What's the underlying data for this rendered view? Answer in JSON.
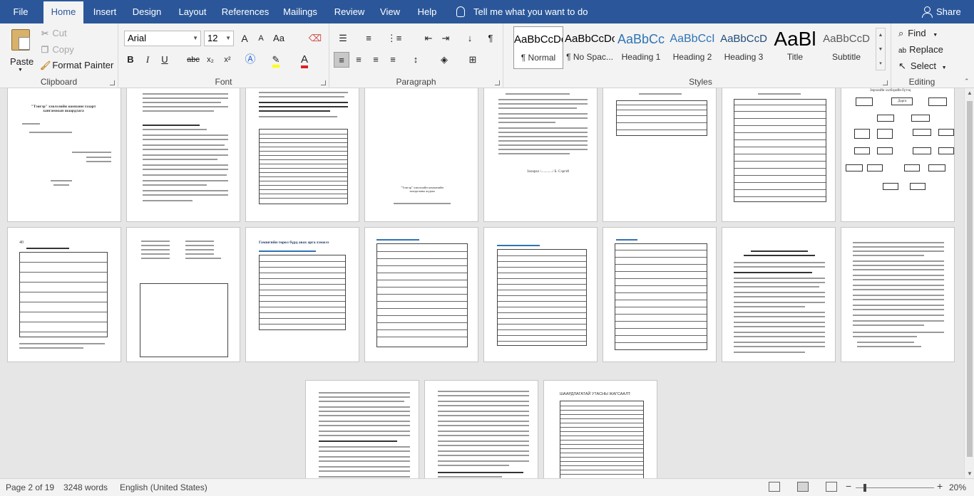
{
  "tabs": [
    "File",
    "Home",
    "Insert",
    "Design",
    "Layout",
    "References",
    "Mailings",
    "Review",
    "View",
    "Help"
  ],
  "active_tab": "Home",
  "tell_me": "Tell me what you want to do",
  "share": "Share",
  "clipboard": {
    "paste": "Paste",
    "cut": "Cut",
    "copy": "Copy",
    "format_painter": "Format Painter",
    "label": "Clipboard"
  },
  "font": {
    "name": "Arial",
    "size": "12",
    "label": "Font",
    "bold": "B",
    "italic": "I",
    "underline": "U",
    "strike": "abc",
    "sub": "x₂",
    "sup": "x²",
    "grow": "A",
    "shrink": "A",
    "case": "Aa"
  },
  "paragraph": {
    "label": "Paragraph"
  },
  "styles": {
    "label": "Styles",
    "items": [
      {
        "preview": "AaBbCcDc",
        "name": "¶ Normal"
      },
      {
        "preview": "AaBbCcDc",
        "name": "¶ No Spac..."
      },
      {
        "preview": "AaBbCc",
        "name": "Heading 1"
      },
      {
        "preview": "AaBbCcI",
        "name": "Heading 2"
      },
      {
        "preview": "AaBbCcD",
        "name": "Heading 3"
      },
      {
        "preview": "AaBl",
        "name": "Title"
      },
      {
        "preview": "AaBbCcD",
        "name": "Subtitle"
      }
    ]
  },
  "editing": {
    "label": "Editing",
    "find": "Find",
    "replace": "Replace",
    "select": "Select"
  },
  "pages": {
    "p1_title": "\"Тэнгэр\" хэвлэлийн компани газарт хангамжын шаардлага",
    "p5_sign": "Захирал /............./ Б. Сэргэй",
    "p4_foot": "\"Тэнгэр\" хэвлэлийн компанийн захиргааны журам",
    "p7_top": "Зөрчлийн хэлбэрийн бүтэц",
    "p7_head": "Дарга",
    "p8_num": "40",
    "p10_title": "Гамшгийн төрөл бүрд авах арга хэмжээ",
    "p18_title": "ШААРДЛАГАТАЙ УТАСНЫ ЖАГСААЛТ"
  },
  "status": {
    "page": "Page 2 of 19",
    "words": "3248 words",
    "lang": "English (United States)",
    "zoom": "20%"
  }
}
